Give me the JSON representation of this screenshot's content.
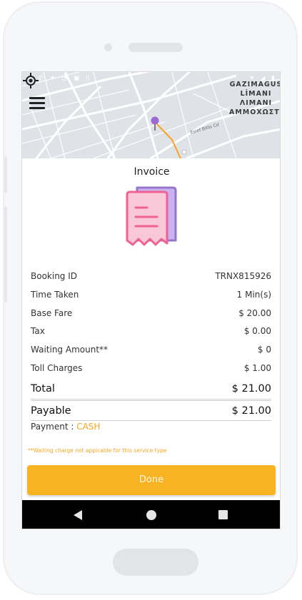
{
  "map": {
    "place_label_lines": [
      "GAZIMAGUS",
      "LİMANI",
      "ΛΙΜΑΝΙ",
      "ΑΜΜΟΧΩΣΤΟ"
    ],
    "street_label": "Esref Bitlis Cd"
  },
  "invoice": {
    "title": "Invoice",
    "rows": [
      {
        "label": "Booking ID",
        "value": "TRNX815926"
      },
      {
        "label": "Time Taken",
        "value": "1 Min(s)"
      },
      {
        "label": "Base Fare",
        "value": "$ 20.00"
      },
      {
        "label": "Tax",
        "value": "$ 0.00"
      },
      {
        "label": "Waiting Amount**",
        "value": "$ 0"
      },
      {
        "label": "Toll Charges",
        "value": "$ 1.00"
      }
    ],
    "total": {
      "label": "Total",
      "value": "$ 21.00"
    },
    "payable": {
      "label": "Payable",
      "value": "$ 21.00"
    },
    "payment_label": "Payment : ",
    "payment_method": "CASH",
    "note": "**Waiting charge not appicable for this service type",
    "done_label": "Done"
  },
  "icons": [
    "menu-icon",
    "my-location-icon",
    "map-pin-icon",
    "receipt-icon",
    "back-icon",
    "home-icon",
    "recents-icon"
  ],
  "colors": {
    "accent": "#f7b322",
    "receipt_pink": "#f06292",
    "receipt_purple": "#9575cd",
    "route": "#f5a623"
  }
}
